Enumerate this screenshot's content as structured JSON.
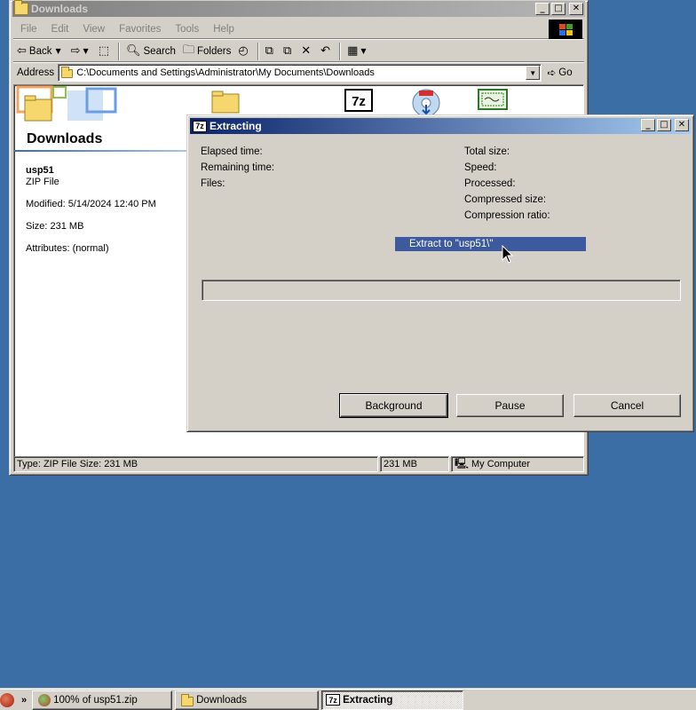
{
  "explorer": {
    "title": "Downloads",
    "menu": [
      "File",
      "Edit",
      "View",
      "Favorites",
      "Tools",
      "Help"
    ],
    "toolbar": {
      "back_label": "Back",
      "search_label": "Search",
      "folders_label": "Folders"
    },
    "address": {
      "label": "Address",
      "value": "C:\\Documents and Settings\\Administrator\\My Documents\\Downloads",
      "go_label": "Go"
    },
    "sidebar": {
      "folder_name": "Downloads",
      "file_name": "usp51",
      "file_type": "ZIP File",
      "modified": "Modified: 5/14/2024 12:40 PM",
      "size": "Size: 231 MB",
      "attributes": "Attributes: (normal)"
    },
    "statusbar": {
      "info": "Type: ZIP File Size: 231 MB",
      "size": "231 MB",
      "zone": "My Computer"
    }
  },
  "dialog": {
    "title": "Extracting",
    "app_icon_text": "7z",
    "left_labels": [
      "Elapsed time:",
      "Remaining time:",
      "Files:"
    ],
    "right_labels": [
      "Total size:",
      "Speed:",
      "Processed:",
      "Compressed size:",
      "Compression ratio:"
    ],
    "destination": "Extract to \"usp51\\\"",
    "progress_fraction": 0,
    "buttons": {
      "background": "Background",
      "pause": "Pause",
      "cancel": "Cancel"
    }
  },
  "taskbar": {
    "tasks": [
      {
        "label": "100% of usp51.zip",
        "icon": "download-progress-icon"
      },
      {
        "label": "Downloads",
        "icon": "folder-icon"
      },
      {
        "label": "Extracting",
        "icon": "7zip-icon"
      }
    ],
    "chevron": "»"
  }
}
